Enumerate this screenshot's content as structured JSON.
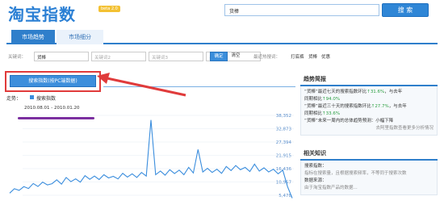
{
  "header": {
    "logo_text": "淘宝指数",
    "beta_badge": "beta 2.0",
    "search_value": "货棒",
    "search_button": "搜 索"
  },
  "tabs": [
    {
      "label": "市场趋势",
      "active": true
    },
    {
      "label": "市场细分",
      "active": false
    }
  ],
  "filters": {
    "keyword_label": "关键词：",
    "keyword1": "货棒",
    "keyword2": "关键词2",
    "keyword3": "关键词3",
    "keyword4": "关键词4",
    "confirm": "确定",
    "clear": "清空",
    "hot_label": "最近热搜词：",
    "hot": [
      "打底裤",
      "货棒",
      "优惠"
    ]
  },
  "main": {
    "big_button": "搜索指数(按PC端数据)",
    "trend_label": "走势：",
    "legend": "搜索指数",
    "date_range": "2010.08.01 - 2010.01.20"
  },
  "chart_data": {
    "type": "line",
    "title": "",
    "y_ticks": [
      "38,352",
      "32,873",
      "27,394",
      "21,915",
      "16,436",
      "10,957",
      "5,478"
    ],
    "series": [
      {
        "name": "搜索指数",
        "values": [
          6200,
          8100,
          7400,
          9000,
          8200,
          10400,
          9100,
          11000,
          9800,
          10300,
          12000,
          10100,
          13000,
          11200,
          12400,
          11000,
          13800,
          12200,
          13600,
          12100,
          14200,
          12800,
          13500,
          12400,
          14800,
          13200,
          14600,
          13000,
          15200,
          13600,
          38000,
          14200,
          15800,
          14000,
          16400,
          14700,
          16200,
          14200,
          17400,
          15000,
          25200,
          15400,
          17000,
          15200,
          16600,
          14800,
          17800,
          16000,
          18200,
          16400,
          17400,
          15600,
          18800,
          15800,
          17200,
          15400,
          16600,
          14600,
          16200,
          9000,
          4000
        ]
      }
    ],
    "color": "#3a8ddd"
  },
  "panel": {
    "title": "趋势简报",
    "lines": [
      {
        "text": "“货棒”最近七天的搜索指数环比",
        "up": "31.6%",
        "tail": "，与去年"
      },
      {
        "text": "同期相比",
        "up": "94.0%",
        "tail": ""
      },
      {
        "text": "“货棒”最近三十天的搜索指数环比",
        "up": "27.7%",
        "tail": "，与去年"
      },
      {
        "text": "同期相比",
        "up": "33.6%",
        "tail": ""
      },
      {
        "text": "“货棒”未来一周内的总体趋势预测：小幅下降",
        "up": "",
        "tail": ""
      }
    ],
    "more": "去阿里指数查看更多分析情况",
    "title2": "相关知识",
    "k1_title": "搜索指数：",
    "k1_desc": "指标在搜索量，且根据搜索频率，不等同于搜索次数",
    "k2_title": "数据来源：",
    "k2_desc": "由于淘宝指数产品的数据..."
  }
}
